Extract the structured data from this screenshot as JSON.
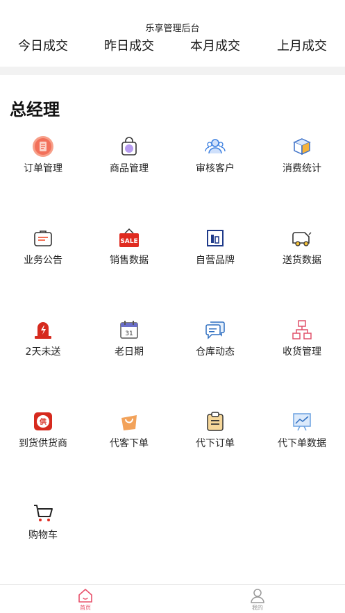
{
  "header": {
    "title": "乐享管理后台",
    "stats_tabs": [
      "今日成交",
      "昨日成交",
      "本月成交",
      "上月成交"
    ]
  },
  "role_title": "总经理",
  "grid": [
    {
      "label": "订单管理",
      "icon": "order-doc-icon"
    },
    {
      "label": "商品管理",
      "icon": "shopping-bag-icon"
    },
    {
      "label": "审核客户",
      "icon": "users-icon"
    },
    {
      "label": "消费统计",
      "icon": "box-cube-icon"
    },
    {
      "label": "业务公告",
      "icon": "briefcase-notice-icon"
    },
    {
      "label": "销售数据",
      "icon": "sale-tag-icon"
    },
    {
      "label": "自营品牌",
      "icon": "building-icon"
    },
    {
      "label": "送货数据",
      "icon": "delivery-truck-icon"
    },
    {
      "label": "2天未送",
      "icon": "alarm-light-icon"
    },
    {
      "label": "老日期",
      "icon": "calendar-icon"
    },
    {
      "label": "仓库动态",
      "icon": "chat-bubbles-icon"
    },
    {
      "label": "收货管理",
      "icon": "boxes-network-icon"
    },
    {
      "label": "到货供货商",
      "icon": "supplier-badge-icon"
    },
    {
      "label": "代客下单",
      "icon": "paper-bag-icon"
    },
    {
      "label": "代下订单",
      "icon": "clipboard-icon"
    },
    {
      "label": "代下单数据",
      "icon": "presentation-chart-icon"
    },
    {
      "label": "购物车",
      "icon": "cart-icon"
    }
  ],
  "tabbar": {
    "home_label": "首页",
    "mine_label": "我的"
  },
  "colors": {
    "accent": "#e8506a",
    "divider": "#f2f2f2"
  }
}
